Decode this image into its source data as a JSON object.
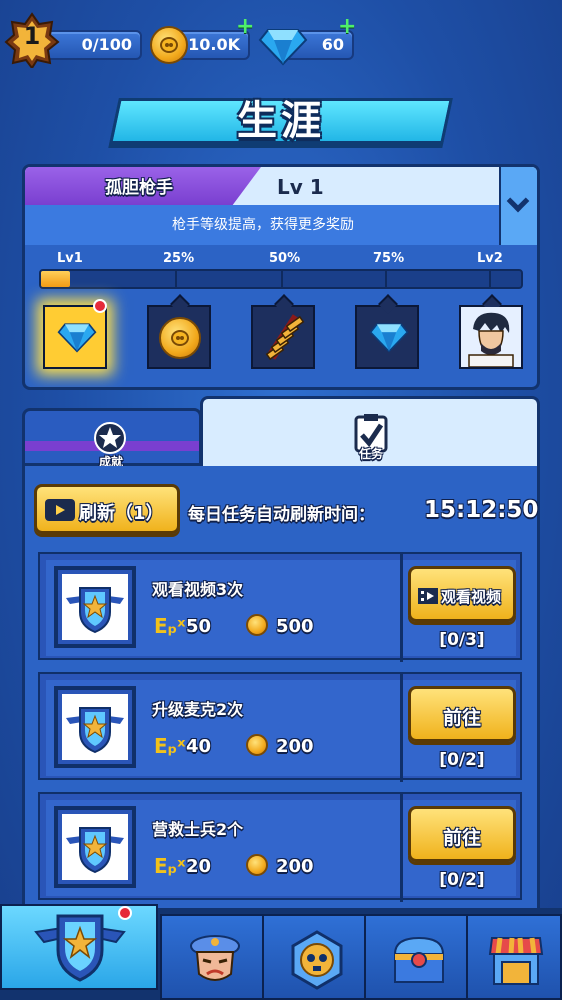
{
  "resources": {
    "level": "1",
    "exp": "0/100",
    "gold": "10.0K",
    "gems": "60",
    "plus": "+"
  },
  "title": "生涯",
  "career": {
    "rank_name": "孤胆枪手",
    "level": "Lv 1",
    "subtitle": "枪手等级提高，获得更多奖励",
    "milestones": [
      "Lv1",
      "25%",
      "50%",
      "75%",
      "Lv2"
    ],
    "progress": 0.06,
    "rewards": [
      {
        "icon": "gem-icon",
        "highlighted": true
      },
      {
        "icon": "coin-icon"
      },
      {
        "icon": "ammo-belt-icon"
      },
      {
        "icon": "gem-icon"
      },
      {
        "icon": "character-portrait-icon"
      }
    ]
  },
  "tabs": {
    "achievement": "成就",
    "tasks": "任务"
  },
  "daily": {
    "refresh_label": "刷新（1）",
    "reset_label": "每日任务自动刷新时间：",
    "reset_time": "15:12:50"
  },
  "tasks": [
    {
      "name": "观看视频3次",
      "exp": "50",
      "gold": "500",
      "button": "观看视频",
      "progress": "[0/3]"
    },
    {
      "name": "升级麦克2次",
      "exp": "40",
      "gold": "200",
      "button": "前往",
      "progress": "[0/2]"
    },
    {
      "name": "营救士兵2个",
      "exp": "20",
      "gold": "200",
      "button": "前往",
      "progress": "[0/2]"
    }
  ],
  "exp_symbol": "Eₚˣ",
  "colors": {
    "accent_gold": "#f0b21c",
    "panel_blue": "#2c63c5",
    "rank_purple": "#7a3fd0",
    "alert_red": "#e62a3a"
  },
  "nav": [
    "career-rank-icon",
    "commander-icon",
    "skull-badge-icon",
    "treasure-chest-icon",
    "shop-icon"
  ]
}
